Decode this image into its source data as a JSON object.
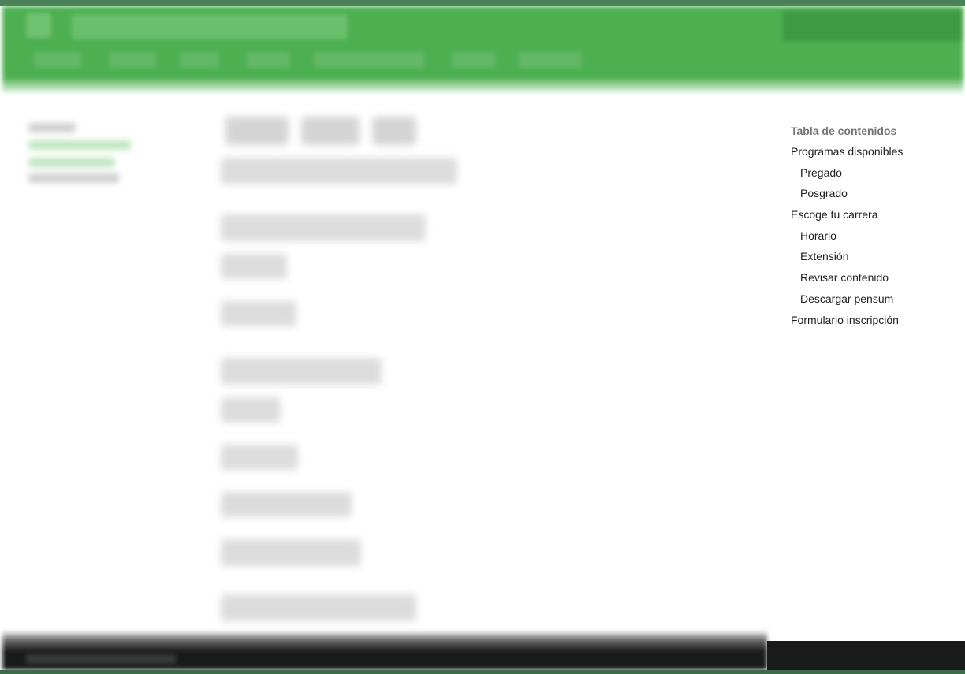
{
  "toc": {
    "title": "Tabla de contenidos",
    "items": [
      {
        "label": "Programas disponibles",
        "level": 1
      },
      {
        "label": "Pregado",
        "level": 2
      },
      {
        "label": "Posgrado",
        "level": 2
      },
      {
        "label": "Escoge tu carrera",
        "level": 1
      },
      {
        "label": "Horario",
        "level": 2
      },
      {
        "label": "Extensión",
        "level": 2
      },
      {
        "label": "Revisar contenido",
        "level": 2
      },
      {
        "label": "Descargar pensum",
        "level": 2
      },
      {
        "label": "Formulario inscripción",
        "level": 1
      }
    ]
  },
  "colors": {
    "header": "#4caf50",
    "footer": "#1a1a1a",
    "toc_title": "#757575",
    "toc_text": "#212121"
  }
}
